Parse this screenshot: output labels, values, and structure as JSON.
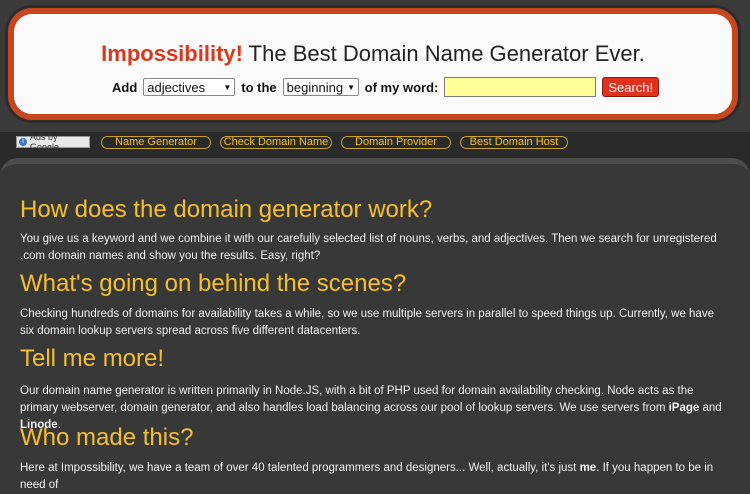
{
  "header": {
    "brand": "Impossibility!",
    "tagline": "The Best Domain Name Generator Ever.",
    "form": {
      "add_label": "Add",
      "type_select": "adjectives",
      "to_the_label": "to the",
      "position_select": "beginning",
      "of_my_word_label": "of my word:",
      "word_value": "",
      "search_label": "Search!"
    }
  },
  "nav": {
    "ads_label": "Ads by Google",
    "links": [
      "Name Generator",
      "Check Domain Name",
      "Domain Provider",
      "Best Domain Host"
    ]
  },
  "sections": [
    {
      "heading": "How does the domain generator work?",
      "body": "You give us a keyword and we combine it with our carefully selected list of nouns, verbs, and adjectives. Then we search for unregistered .com domain names and show you the results. Easy, right?"
    },
    {
      "heading": "What's going on behind the scenes?",
      "body": "Checking hundreds of domains for availability takes a while, so we use multiple servers in parallel to speed things up. Currently, we have six domain lookup servers spread across five different datacenters."
    },
    {
      "heading": "Tell me more!",
      "body_pre": "Our domain name generator is written primarily in Node.JS, with a bit of PHP used for domain availability checking. Node acts as the primary webserver, domain generator, and also handles load balancing across our pool of lookup servers. We use servers from ",
      "bold_1": "iPage",
      "body_mid": " and ",
      "bold_2": "Linode",
      "body_post": "."
    },
    {
      "heading": "Who made this?",
      "body_pre": "Here at Impossibility, we have a team of over 40 talented programmers and designers... Well, actually, it's just ",
      "bold_1": "me",
      "body_post": ". If you happen to be in need of"
    }
  ],
  "colors": {
    "brand_red": "#d9381e",
    "frame_orange": "#c6461f",
    "heading_yellow": "#f5c02c",
    "input_yellow": "#ffff99"
  }
}
